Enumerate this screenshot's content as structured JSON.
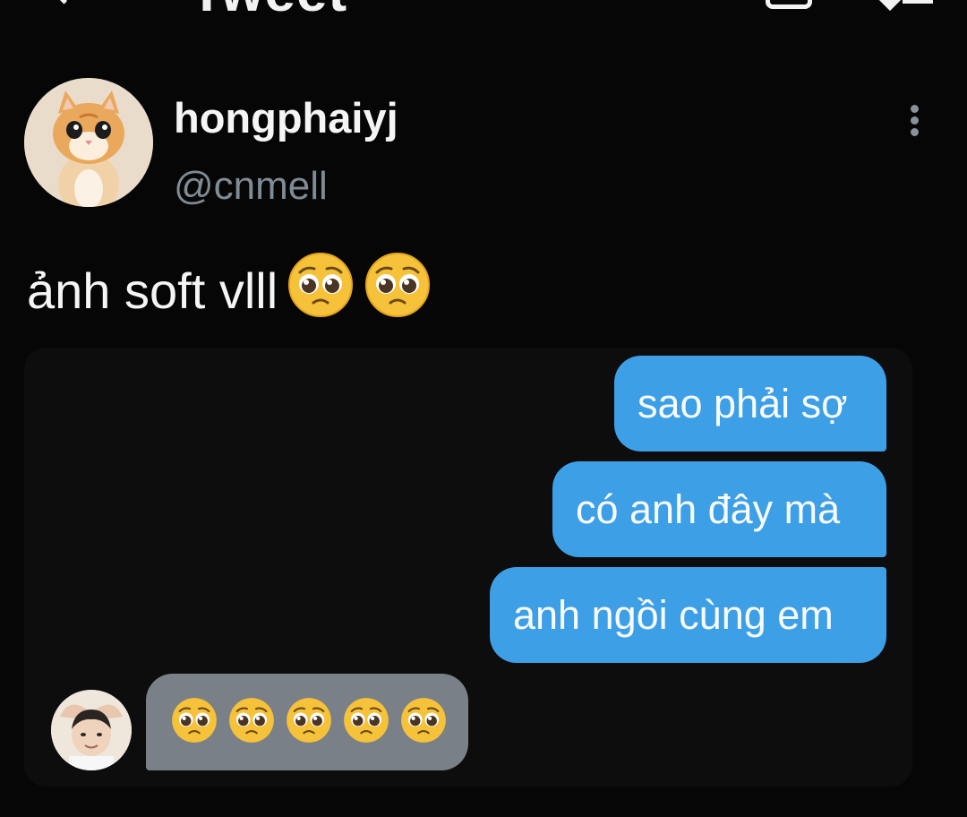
{
  "header": {
    "title": "Tweet",
    "back_icon": "back-arrow-icon",
    "camera_icon": "camera-icon",
    "right_icon": "heart-list-icon"
  },
  "tweet": {
    "author_name": "hongphaiyj",
    "author_handle": "@cnmell",
    "text": "ảnh soft vlll",
    "text_emojis": [
      "pleading-face",
      "pleading-face"
    ],
    "more_icon": "more-vertical-icon"
  },
  "media": {
    "sent_messages": [
      "sao phải sợ",
      "có anh đây mà",
      "anh ngồi cùng em"
    ],
    "received_emojis": [
      "pleading-face",
      "pleading-face",
      "pleading-face",
      "pleading-face",
      "pleading-face"
    ],
    "colors": {
      "sent_bubble": "#3d9fe6",
      "received_bubble": "#7a8087",
      "background": "#0d0d0d"
    }
  },
  "colors": {
    "page_background": "#060606",
    "handle": "#7f8b95",
    "emoji_face": "#f6c23a"
  }
}
